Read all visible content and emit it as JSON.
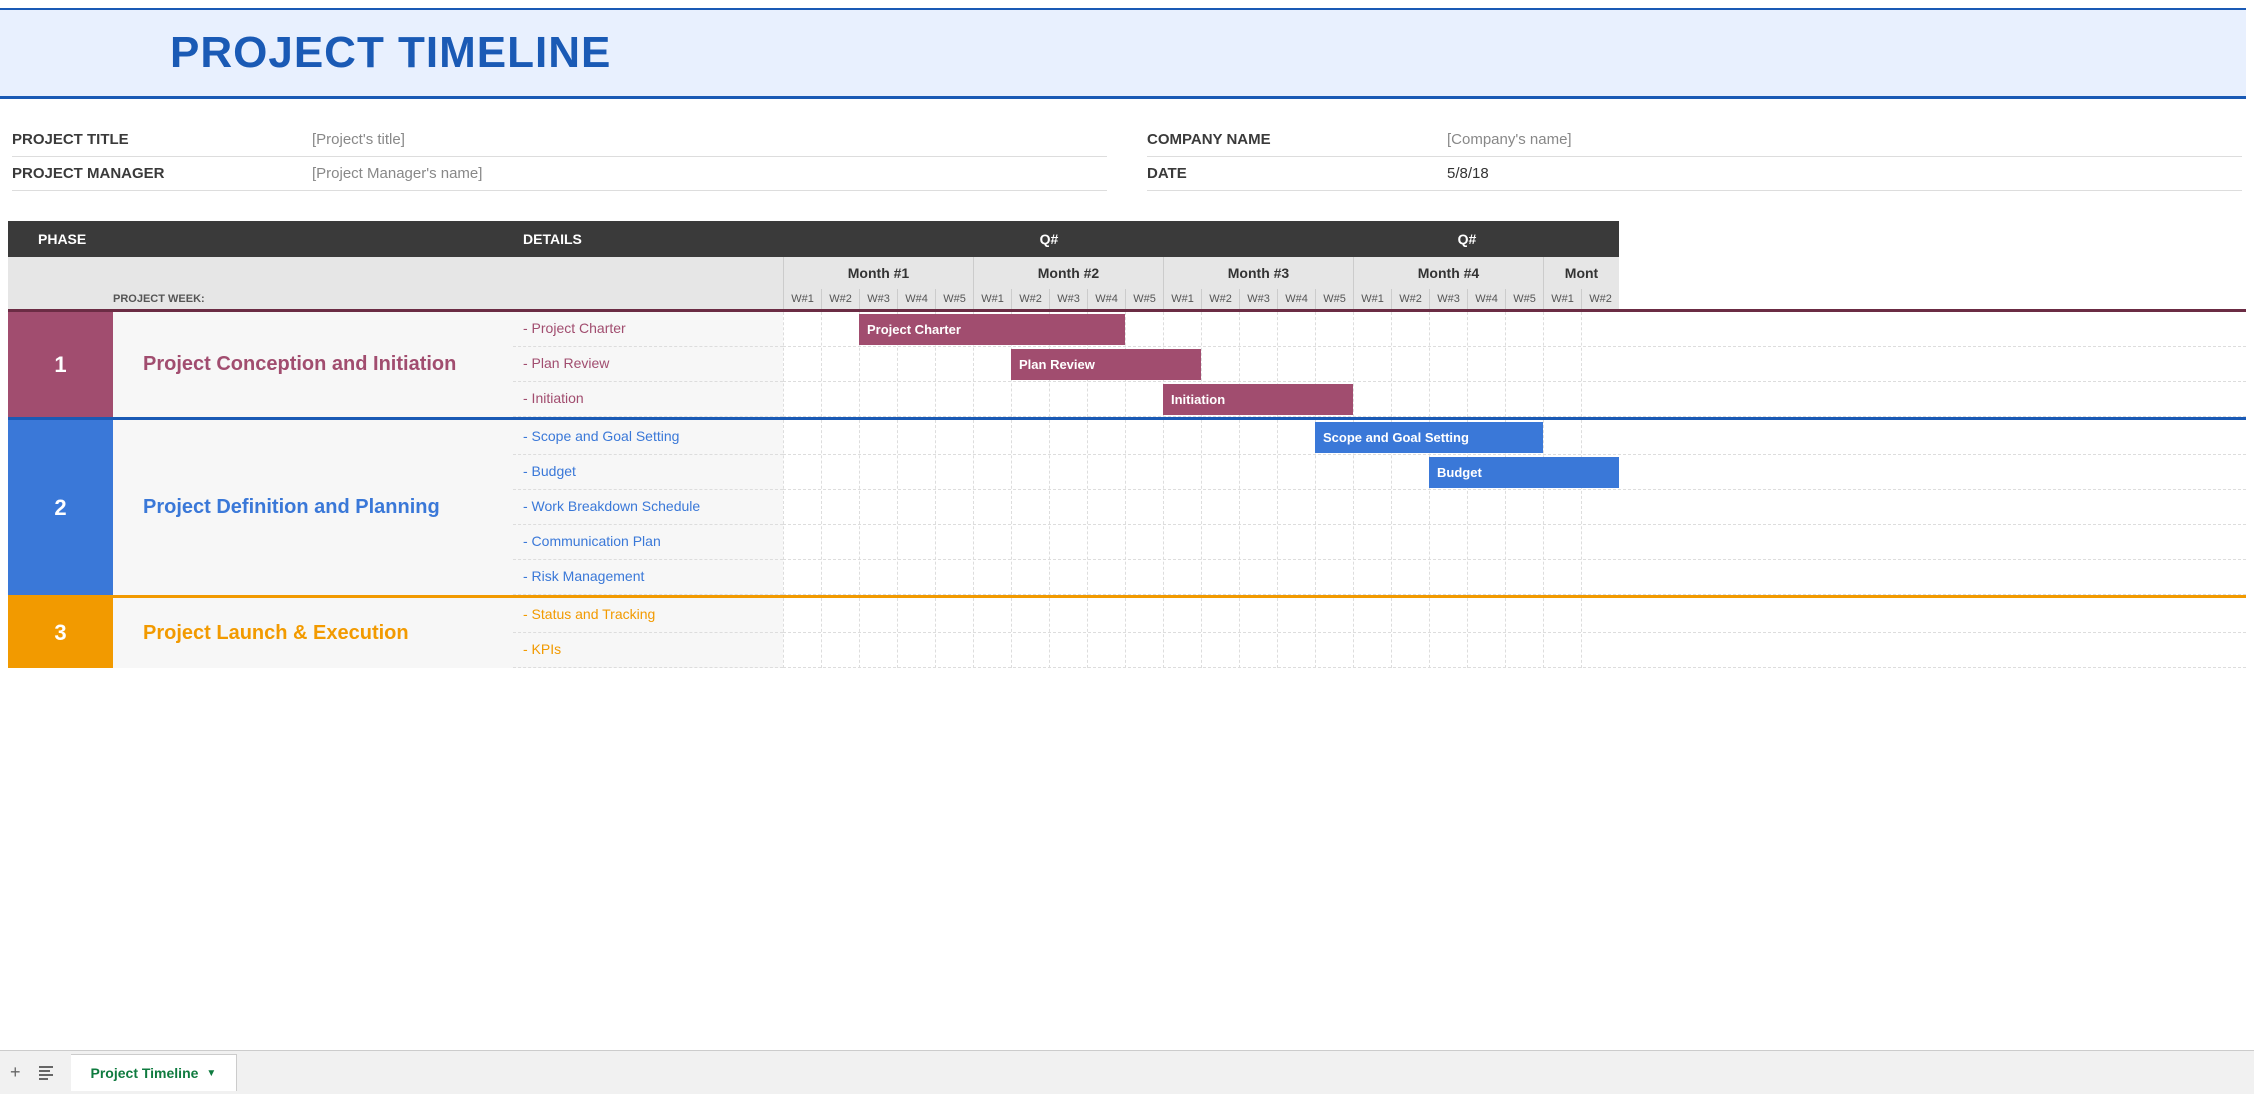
{
  "banner": {
    "title": "PROJECT TIMELINE"
  },
  "meta": {
    "left": [
      {
        "label": "PROJECT TITLE",
        "value": "[Project's title]",
        "filled": false
      },
      {
        "label": "PROJECT MANAGER",
        "value": "[Project Manager's name]",
        "filled": false
      }
    ],
    "right": [
      {
        "label": "COMPANY NAME",
        "value": "[Company's name]",
        "filled": false
      },
      {
        "label": "DATE",
        "value": "5/8/18",
        "filled": true
      }
    ]
  },
  "headers": {
    "phase": "PHASE",
    "details": "DETAILS",
    "quarters": [
      "Q#",
      "Q#"
    ],
    "months": [
      "Month #1",
      "Month #2",
      "Month #3",
      "Month #4",
      "Mont"
    ],
    "project_week_label": "PROJECT WEEK:",
    "weeks": [
      "W#1",
      "W#2",
      "W#3",
      "W#4",
      "W#5",
      "W#1",
      "W#2",
      "W#3",
      "W#4",
      "W#5",
      "W#1",
      "W#2",
      "W#3",
      "W#4",
      "W#5",
      "W#1",
      "W#2",
      "W#3",
      "W#4",
      "W#5",
      "W#1",
      "W#2"
    ]
  },
  "phases": [
    {
      "num": "1",
      "name": "Project Conception and Initiation",
      "color": "maroon",
      "details": [
        "- Project Charter",
        "- Plan Review",
        "- Initiation"
      ],
      "bars": [
        {
          "row": 0,
          "start": 2,
          "span": 7,
          "label": "Project Charter"
        },
        {
          "row": 1,
          "start": 6,
          "span": 5,
          "label": "Plan Review"
        },
        {
          "row": 2,
          "start": 10,
          "span": 5,
          "label": "Initiation"
        }
      ]
    },
    {
      "num": "2",
      "name": "Project Definition and Planning",
      "color": "blue",
      "details": [
        "- Scope and Goal Setting",
        "- Budget",
        "- Work Breakdown Schedule",
        "- Communication Plan",
        "- Risk Management"
      ],
      "bars": [
        {
          "row": 0,
          "start": 14,
          "span": 6,
          "label": "Scope and Goal Setting"
        },
        {
          "row": 1,
          "start": 17,
          "span": 5,
          "label": "Budget"
        }
      ]
    },
    {
      "num": "3",
      "name": "Project Launch & Execution",
      "color": "orange",
      "details": [
        "- Status and Tracking",
        "- KPIs"
      ],
      "bars": []
    }
  ],
  "footer": {
    "sheet_name": "Project Timeline"
  }
}
